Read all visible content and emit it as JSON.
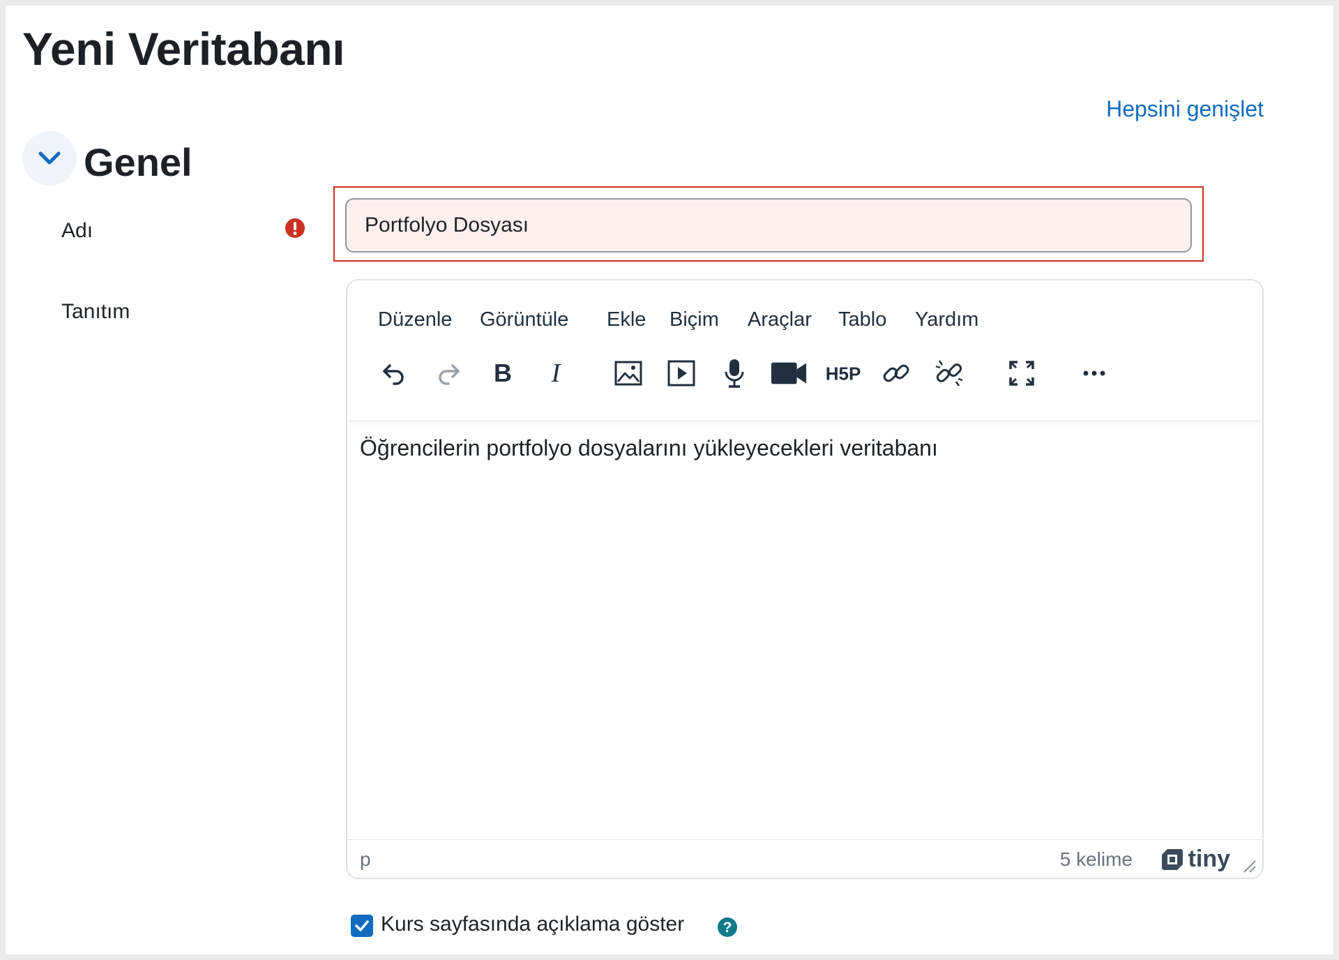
{
  "page": {
    "title": "Yeni Veritabanı",
    "expand_all": "Hepsini genişlet"
  },
  "section": {
    "title": "Genel",
    "icon": "chevron-down-icon"
  },
  "name_field": {
    "label": "Adı",
    "value": "Portfolyo Dosyası",
    "required_icon": "exclamation-circle-icon",
    "error_color": "#ca3120"
  },
  "intro_field": {
    "label": "Tanıtım"
  },
  "editor": {
    "menu": [
      "Düzenle",
      "Görüntüle",
      "Ekle",
      "Biçim",
      "Araçlar",
      "Tablo",
      "Yardım"
    ],
    "toolbar_icons": [
      "undo-icon",
      "redo-icon",
      "bold-icon",
      "italic-icon",
      "image-icon",
      "media-icon",
      "microphone-icon",
      "video-camera-icon",
      "h5p-icon",
      "link-icon",
      "unlink-icon",
      "fullscreen-icon",
      "more-icon"
    ],
    "content": "Öğrencilerin portfolyo dosyalarını yükleyecekleri veritabanı",
    "path": "p",
    "word_count": "5 kelime",
    "brand": "tiny"
  },
  "show_description": {
    "label": "Kurs sayfasında açıklama göster",
    "checked": true,
    "help_icon": "question-circle-icon"
  },
  "colors": {
    "link": "#0f6cbf",
    "checkbox": "#0f6cbf",
    "help": "#0f7a8a",
    "error": "#ca3120"
  }
}
